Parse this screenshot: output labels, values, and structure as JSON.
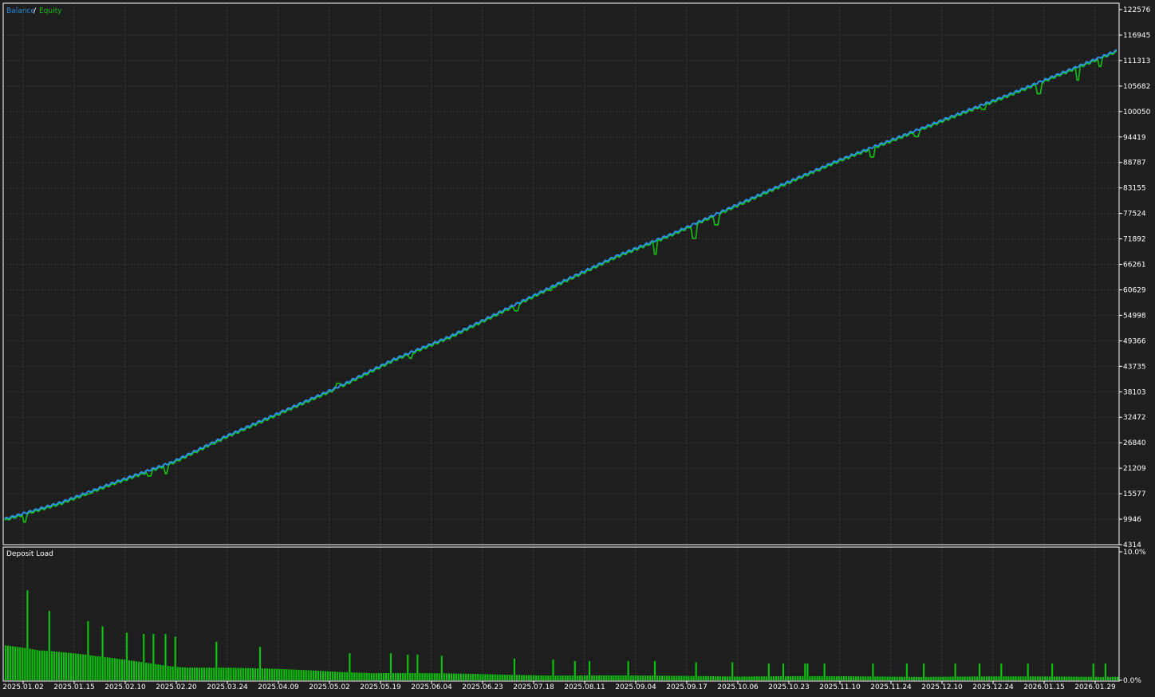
{
  "legend": {
    "balance_label": "Balance",
    "separator": "/",
    "equity_label": "Equity",
    "balance_color": "#2d8fe0",
    "equity_color": "#14c414"
  },
  "sub_panel": {
    "title": "Deposit Load"
  },
  "colors": {
    "background": "#1e1e1e",
    "grid": "#3a3a3a",
    "axis_text": "#ffffff",
    "separator": "#ffffff",
    "bar": "#0fbf0f"
  },
  "chart_data": [
    {
      "type": "line",
      "title": "",
      "xlabel": "",
      "ylabel": "",
      "ylim": [
        4314,
        122576
      ],
      "y_ticks": [
        "122576",
        "116945",
        "111313",
        "105682",
        "100050",
        "94419",
        "88787",
        "83155",
        "77524",
        "71892",
        "66261",
        "60629",
        "54998",
        "49366",
        "43735",
        "38103",
        "32472",
        "26840",
        "21209",
        "15577",
        "9946",
        "4314"
      ],
      "x_ticks": [
        "2025.01.02",
        "2025.01.15",
        "2025.02.10",
        "2025.02.20",
        "2025.03.24",
        "2025.04.09",
        "2025.05.02",
        "2025.05.19",
        "2025.06.04",
        "2025.06.23",
        "2025.07.18",
        "2025.08.11",
        "2025.09.04",
        "2025.09.17",
        "2025.10.06",
        "2025.10.23",
        "2025.11.10",
        "2025.11.24",
        "2025.12.10",
        "2025.12.24",
        "2026.01.15",
        "2026.01.29"
      ],
      "grid": true,
      "series": [
        {
          "name": "Balance",
          "x": [
            0,
            0.05,
            0.1,
            0.15,
            0.2,
            0.25,
            0.3,
            0.35,
            0.4,
            0.45,
            0.5,
            0.55,
            0.6,
            0.65,
            0.7,
            0.75,
            0.8,
            0.85,
            0.9,
            0.95,
            1.0
          ],
          "values": [
            10000,
            13600,
            18200,
            22500,
            28400,
            33800,
            39200,
            45300,
            50300,
            56300,
            62300,
            68100,
            73000,
            78500,
            84000,
            89300,
            94000,
            98800,
            103500,
            108500,
            113500
          ]
        },
        {
          "name": "Equity",
          "dips": [
            [
              0.018,
              9300
            ],
            [
              0.075,
              15500
            ],
            [
              0.13,
              19500
            ],
            [
              0.145,
              20000
            ],
            [
              0.185,
              26500
            ],
            [
              0.3,
              40000
            ],
            [
              0.345,
              44500
            ],
            [
              0.365,
              45500
            ],
            [
              0.46,
              56000
            ],
            [
              0.49,
              60500
            ],
            [
              0.585,
              68500
            ],
            [
              0.62,
              72000
            ],
            [
              0.64,
              75000
            ],
            [
              0.73,
              87000
            ],
            [
              0.78,
              90000
            ],
            [
              0.82,
              94500
            ],
            [
              0.88,
              100500
            ],
            [
              0.93,
              104000
            ],
            [
              0.965,
              107000
            ],
            [
              0.985,
              110000
            ]
          ]
        }
      ]
    },
    {
      "type": "bar",
      "title": "Deposit Load",
      "ylim": [
        0,
        10
      ],
      "y_ticks": [
        "10.0%",
        "0.0%"
      ],
      "base_profile": [
        [
          0,
          3.2
        ],
        [
          0.03,
          2.5
        ],
        [
          0.08,
          1.9
        ],
        [
          0.15,
          1.2
        ],
        [
          0.3,
          0.7
        ],
        [
          0.45,
          0.45
        ],
        [
          0.6,
          0.35
        ],
        [
          0.8,
          0.3
        ],
        [
          1.0,
          0.3
        ]
      ],
      "spikes": [
        [
          0.02,
          7.0
        ],
        [
          0.04,
          5.4
        ],
        [
          0.075,
          4.6
        ],
        [
          0.087,
          4.2
        ],
        [
          0.108,
          3.7
        ],
        [
          0.125,
          3.6
        ],
        [
          0.133,
          3.6
        ],
        [
          0.143,
          3.6
        ],
        [
          0.153,
          3.4
        ],
        [
          0.19,
          3.0
        ],
        [
          0.228,
          2.6
        ],
        [
          0.31,
          2.1
        ],
        [
          0.347,
          2.1
        ],
        [
          0.362,
          2.0
        ],
        [
          0.37,
          2.0
        ],
        [
          0.392,
          1.9
        ],
        [
          0.458,
          1.7
        ],
        [
          0.492,
          1.6
        ],
        [
          0.512,
          1.5
        ],
        [
          0.525,
          1.5
        ],
        [
          0.56,
          1.5
        ],
        [
          0.583,
          1.5
        ],
        [
          0.62,
          1.4
        ],
        [
          0.654,
          1.4
        ],
        [
          0.686,
          1.3
        ],
        [
          0.7,
          1.3
        ],
        [
          0.72,
          1.3
        ],
        [
          0.736,
          1.3
        ],
        [
          0.78,
          1.3
        ],
        [
          0.81,
          1.3
        ],
        [
          0.826,
          1.3
        ],
        [
          0.854,
          1.3
        ],
        [
          0.876,
          1.3
        ],
        [
          0.895,
          1.3
        ],
        [
          0.92,
          1.3
        ],
        [
          0.942,
          1.3
        ],
        [
          0.978,
          1.3
        ],
        [
          0.99,
          1.3
        ]
      ]
    }
  ]
}
